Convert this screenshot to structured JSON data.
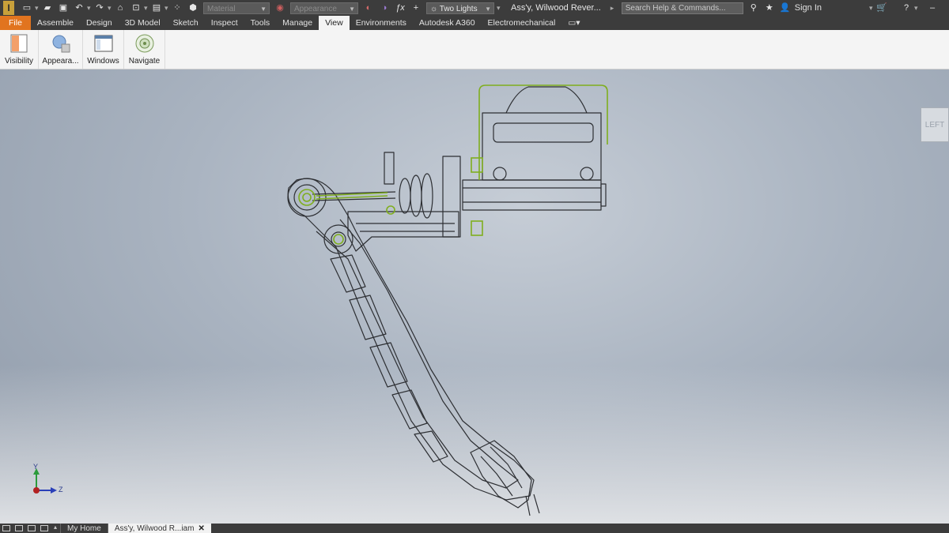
{
  "titlebar": {
    "app_letter": "I",
    "material": "Material",
    "appearance": "Appearance",
    "lighting": "Two Lights",
    "document_title": "Ass'y, Wilwood Rever...",
    "search_placeholder": "Search Help & Commands...",
    "sign_in": "Sign In"
  },
  "tabs": [
    "File",
    "Assemble",
    "Design",
    "3D Model",
    "Sketch",
    "Inspect",
    "Tools",
    "Manage",
    "View",
    "Environments",
    "Autodesk A360",
    "Electromechanical"
  ],
  "active_tab": "View",
  "ribbon": {
    "buttons": [
      "Visibility",
      "Appeara...",
      "Windows",
      "Navigate"
    ]
  },
  "viewcube": {
    "face": "LEFT"
  },
  "axes": {
    "y": "Y",
    "z": "Z"
  },
  "doc_tabs": [
    "My Home",
    "Ass'y, Wilwood R...iam"
  ],
  "colors": {
    "file_tab": "#e1741f",
    "highlight": "#7fae1e",
    "wire": "#2d2f33"
  }
}
